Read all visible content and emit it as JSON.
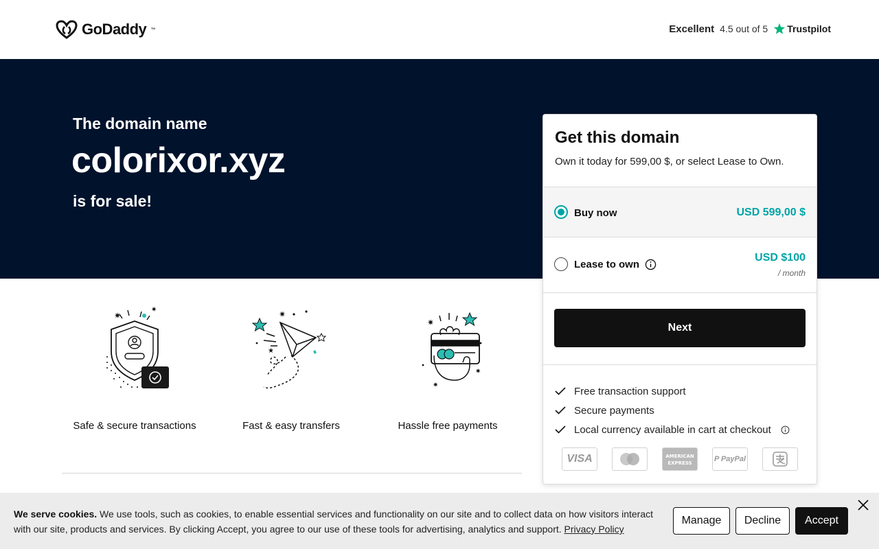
{
  "header": {
    "logo_text": "GoDaddy",
    "logo_tm": "™",
    "trust_rating_word": "Excellent",
    "trust_score": "4.5 out of 5",
    "trust_brand": "Trustpilot"
  },
  "hero": {
    "pre_title": "The domain name",
    "domain": "colorixor.xyz",
    "post_title": "is for sale!"
  },
  "features": [
    {
      "label": "Safe & secure transactions",
      "icon": "shield-user-icon"
    },
    {
      "label": "Fast & easy transfers",
      "icon": "paper-plane-icon"
    },
    {
      "label": "Hassle free payments",
      "icon": "hand-card-icon"
    }
  ],
  "purchase_card": {
    "title": "Get this domain",
    "subtitle": "Own it today for 599,00 $, or select Lease to Own.",
    "options": [
      {
        "label": "Buy now",
        "price": "USD 599,00 $",
        "selected": true
      },
      {
        "label": "Lease to own",
        "price": "USD $100",
        "unit": "/ month",
        "selected": false
      }
    ],
    "cta_label": "Next",
    "benefits": [
      "Free transaction support",
      "Secure payments",
      "Local currency available in cart at checkout"
    ],
    "payment_methods": [
      "VISA",
      "Mastercard",
      "American Express",
      "PayPal",
      "Alipay"
    ]
  },
  "cookie_banner": {
    "heading": "We serve cookies.",
    "body": " We use tools, such as cookies, to enable essential services and functionality on our site and to collect data on how visitors interact with our site, products and services. By clicking Accept, you agree to our use of these tools for advertising, analytics and support. ",
    "link_label": "Privacy Policy",
    "manage_label": "Manage",
    "decline_label": "Decline",
    "accept_label": "Accept"
  },
  "colors": {
    "hero_bg": "#00122c",
    "accent_teal": "#00a4a6",
    "button_dark": "#111111",
    "trustpilot_green": "#00b67a"
  }
}
